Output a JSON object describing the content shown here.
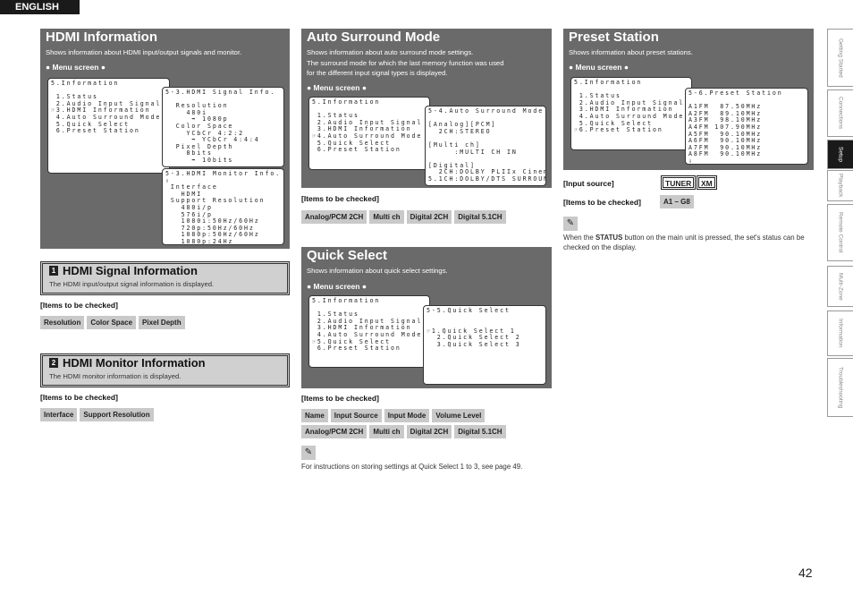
{
  "language": "ENGLISH",
  "page_number": "42",
  "sidebar": {
    "active": "Setup",
    "items": [
      "Getting Started",
      "Connections",
      "Setup",
      "Playback",
      "Remote Control",
      "Multi-Zone",
      "Information",
      "Troubleshooting"
    ]
  },
  "hdmi": {
    "title": "HDMI Information",
    "subtitle": "Shows information about HDMI input/output signals and monitor.",
    "menu_label": "● Menu screen ●",
    "screens": [
      {
        "lines": [
          "5.Information",
          "",
          " 1.Status",
          " 2.Audio Input Signal",
          "☞3.HDMI Information",
          " 4.Auto Surround Mode",
          " 5.Quick Select",
          " 6.Preset Station"
        ]
      },
      {
        "lines": [
          "5-3.HDMI Signal Info.",
          "",
          "  Resolution",
          "    480i",
          "     ➡ 1080p",
          "  Color Space",
          "    YCbCr 4:2:2",
          "     ➡ YCbCr 4:4:4",
          "  Pixel Depth",
          "    8bits",
          "     ➡ 10bits"
        ]
      },
      {
        "lines": [
          "5-3.HDMI Monitor Info.",
          "⇧",
          " Interface",
          "   HDMI",
          " Support Resolution",
          "   480i/p",
          "   576i/p",
          "   1080i:50Hz/60Hz",
          "   720p:50Hz/60Hz",
          "   1080p:50Hz/60Hz",
          "   1080p:24Hz"
        ]
      }
    ],
    "sections": [
      {
        "number": "1",
        "title": "HDMI Signal Information",
        "desc": "The HDMI input/output signal information is displayed.",
        "items_label": "[Items to be checked]",
        "items": [
          "Resolution",
          "Color Space",
          "Pixel Depth"
        ]
      },
      {
        "number": "2",
        "title": "HDMI Monitor Information",
        "desc": "The HDMI monitor information is displayed.",
        "items_label": "[Items to be checked]",
        "items": [
          "Interface",
          "Support Resolution"
        ]
      }
    ]
  },
  "auto_surround": {
    "title": "Auto Surround Mode",
    "subtitle": [
      "Shows information about auto surround mode settings.",
      "The surround mode for which the last memory function was used",
      "for the different input signal types is displayed."
    ],
    "menu_label": "● Menu screen ●",
    "screens": [
      {
        "lines": [
          "5.Information",
          "",
          " 1.Status",
          " 2.Audio Input Signal",
          " 3.HDMI Information",
          "☞4.Auto Surround Mode",
          " 5.Quick Select",
          " 6.Preset Station"
        ]
      },
      {
        "lines": [
          "5-4.Auto Surround Mode",
          "",
          "[Analog][PCM]",
          "  2CH:STEREO",
          "",
          "[Multi ch]",
          "     :MULTI CH IN",
          "",
          "[Digital]",
          "  2CH:DOLBY PLIIx Cinema",
          "5.1CH:DOLBY/DTS SURROUND"
        ]
      }
    ],
    "items_label": "[Items to be checked]",
    "items": [
      "Analog/PCM 2CH",
      "Multi ch",
      "Digital 2CH",
      "Digital 5.1CH"
    ]
  },
  "quick_select": {
    "title": "Quick Select",
    "subtitle": "Shows information about quick select settings.",
    "menu_label": "● Menu screen ●",
    "screens": [
      {
        "lines": [
          "5.Information",
          "",
          " 1.Status",
          " 2.Audio Input Signal",
          " 3.HDMI Information",
          " 4.Auto Surround Mode",
          "☞5.Quick Select",
          " 6.Preset Station"
        ]
      },
      {
        "lines": [
          "5-5.Quick Select",
          "",
          "",
          "☞1.Quick Select 1",
          "  2.Quick Select 2",
          "  3.Quick Select 3"
        ]
      }
    ],
    "items_label": "[Items to be checked]",
    "items_row1": [
      "Name",
      "Input Source",
      "Input Mode",
      "Volume Level"
    ],
    "items_row2": [
      "Analog/PCM 2CH",
      "Multi ch",
      "Digital 2CH",
      "Digital 5.1CH"
    ],
    "note": "For instructions on storing settings at Quick Select 1 to 3, see page 49."
  },
  "preset": {
    "title": "Preset Station",
    "subtitle": "Shows information about preset stations.",
    "menu_label": "● Menu screen ●",
    "screens": [
      {
        "lines": [
          "5.Information",
          "",
          " 1.Status",
          " 2.Audio Input Signal",
          " 3.HDMI Information",
          " 4.Auto Surround Mode",
          " 5.Quick Select",
          "☞6.Preset Station"
        ]
      },
      {
        "lines": [
          "5-6.Preset Station",
          "",
          "A1FM  87.50MHz",
          "A2FM  89.10MHz",
          "A3FM  98.10MHz",
          "A4FM 107.90MHz",
          "A5FM  90.10MHz",
          "A6FM  90.10MHz",
          "A7FM  90.10MHz",
          "A8FM  90.10MHz",
          "⇩"
        ]
      }
    ],
    "input_source_label": "[Input source]",
    "input_sources": [
      "TUNER",
      "XM"
    ],
    "items_label": "[Items to be checked]",
    "items": [
      "A1 – G8"
    ],
    "note_pre": "When the ",
    "note_bold": "STATUS",
    "note_post": " button on the main unit is pressed, the set's status can be checked on the display."
  }
}
